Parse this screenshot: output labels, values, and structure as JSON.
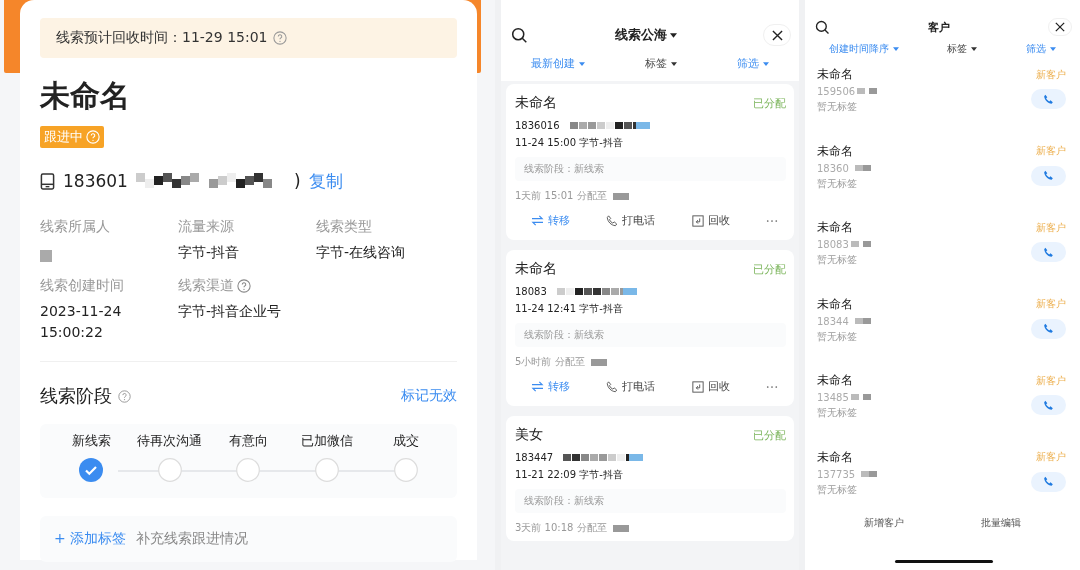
{
  "detail": {
    "recycle_notice": "线索预计回收时间：11-29 15:01",
    "title": "未命名",
    "status_badge": "跟进中",
    "phone": {
      "visible": "183601",
      "redacted": true,
      "suffix": ")",
      "copy": "复制"
    },
    "fields": [
      {
        "label": "线索所属人",
        "redacted": true
      },
      {
        "label": "流量来源",
        "value": "字节-抖音"
      },
      {
        "label": "线索类型",
        "value": "字节-在线咨询"
      },
      {
        "label": "线索创建时间",
        "value": "2023-11-24\n15:00:22"
      },
      {
        "label": "线索渠道",
        "value": "字节-抖音企业号",
        "help": true
      }
    ],
    "stage": {
      "title": "线索阶段",
      "action": "标记无效",
      "steps": [
        {
          "label": "新线索",
          "done": true
        },
        {
          "label": "待再次沟通",
          "done": false
        },
        {
          "label": "有意向",
          "done": false
        },
        {
          "label": "已加微信",
          "done": false
        },
        {
          "label": "成交",
          "done": false
        }
      ]
    },
    "tags": {
      "add": "+ 添加标签",
      "hint": "补充线索跟进情况"
    }
  },
  "leads": {
    "title": "线索公海",
    "filters": [
      {
        "label": "最新创建",
        "selected": true
      },
      {
        "label": "标签",
        "selected": false
      },
      {
        "label": "筛选",
        "selected": true
      }
    ],
    "cards": [
      {
        "name": "未命名",
        "status": "已分配",
        "phone": "1836016",
        "meta": "11-24 15:00  字节-抖音",
        "stage": "线索阶段：新线索",
        "assigned": "1天前 15:01 分配至",
        "actions": [
          {
            "kind": "transfer",
            "label": "转移"
          },
          {
            "kind": "call",
            "label": "打电话"
          },
          {
            "kind": "recycle",
            "label": "回收"
          },
          {
            "kind": "more"
          }
        ]
      },
      {
        "name": "未命名",
        "status": "已分配",
        "phone": "18083",
        "meta": "11-24 12:41  字节-抖音",
        "stage": "线索阶段：新线索",
        "assigned": "5小时前 分配至",
        "actions": [
          {
            "kind": "transfer",
            "label": "转移"
          },
          {
            "kind": "call",
            "label": "打电话"
          },
          {
            "kind": "recycle",
            "label": "回收"
          },
          {
            "kind": "more"
          }
        ]
      },
      {
        "name": "美女",
        "status": "已分配",
        "phone": "183447",
        "meta": "11-21 22:09  字节-抖音",
        "stage": "线索阶段：新线索",
        "assigned": "3天前 10:18 分配至"
      }
    ]
  },
  "customers": {
    "title": "客户",
    "filters": [
      {
        "label": "创建时间降序",
        "selected": true
      },
      {
        "label": "标签",
        "selected": false
      },
      {
        "label": "筛选",
        "selected": true
      }
    ],
    "rows": [
      {
        "name": "未命名",
        "status": "新客户",
        "phone": "159506",
        "tag": "暂无标签"
      },
      {
        "name": "未命名",
        "status": "新客户",
        "phone": "18360",
        "tag": "暂无标签"
      },
      {
        "name": "未命名",
        "status": "新客户",
        "phone": "18083",
        "tag": "暂无标签"
      },
      {
        "name": "未命名",
        "status": "新客户",
        "phone": "18344",
        "tag": "暂无标签"
      },
      {
        "name": "未命名",
        "status": "新客户",
        "phone": "13485",
        "tag": "暂无标签"
      },
      {
        "name": "未命名",
        "status": "新客户",
        "phone": "137735",
        "tag": "暂无标签"
      }
    ],
    "bottom_buttons": [
      "新增客户",
      "批量编辑"
    ]
  }
}
